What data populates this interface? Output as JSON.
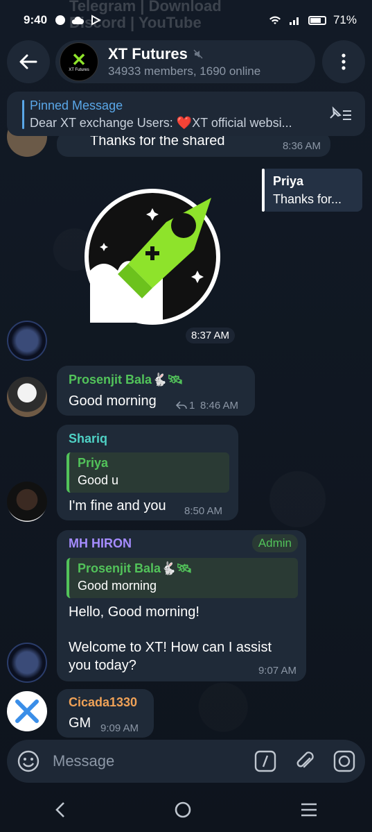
{
  "status_bar": {
    "time": "9:40",
    "battery": "71%",
    "ghost_notif_1": "Telegram  |  Download",
    "ghost_notif_2": "Discord  |  YouTube"
  },
  "header": {
    "title": "XT Futures",
    "subtitle": "34933 members, 1690 online",
    "avatar_label": "XT Futures"
  },
  "pinned": {
    "title": "Pinned Message",
    "body": "Dear XT exchange Users: ❤️XT official websi..."
  },
  "messages": {
    "m0": {
      "text": "Thanks for the shared",
      "time": "8:36 AM"
    },
    "reply_preview": {
      "name": "Priya",
      "text": "Thanks for..."
    },
    "sticker_time": "8:37 AM",
    "m1": {
      "sender": "Prosenjit Bala🐇🛰",
      "text": "Good morning",
      "replies": "1",
      "time": "8:46 AM"
    },
    "m2": {
      "sender": "Shariq",
      "quote_name": "Priya",
      "quote_text": "Good u",
      "text": "I'm fine and you",
      "time": "8:50 AM"
    },
    "m3": {
      "sender": "MH HIRON",
      "badge": "Admin",
      "quote_name": "Prosenjit Bala🐇🛰",
      "quote_text": "Good morning",
      "text_line1": "Hello, Good morning!",
      "text_line2": "Welcome to XT! How can I assist",
      "text_line3": "you today?",
      "time": "9:07 AM"
    },
    "m4": {
      "sender": "Cicada1330",
      "text": "GM",
      "time": "9:09 AM"
    }
  },
  "composer": {
    "placeholder": "Message"
  },
  "colors": {
    "accent_blue": "#5aa7e8",
    "green_name": "#52c35a",
    "teal_name": "#4fd1c5",
    "purple_name": "#a58cff",
    "orange_name": "#f0a257",
    "admin_badge": "#52c35a"
  }
}
